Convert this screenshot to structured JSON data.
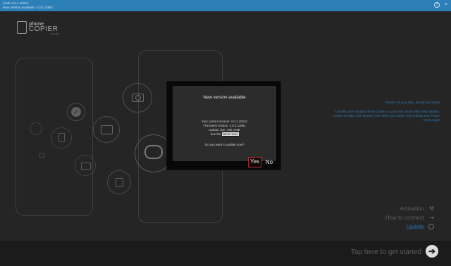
{
  "titlebar": {
    "line1": "Vmdr 4.0.1.10216",
    "line2": "New version available: 4.0.2.11691",
    "help_icon": "?",
    "close_icon": "×"
  },
  "logo": {
    "line1": "phone",
    "line2": "COPIER",
    "line3": "by Vmdr"
  },
  "right_panel": {
    "tagline": "Transfer all your data, quickly and easily",
    "description": "Transfer your valuable phone content to your new phone with a few minutes. Content remains both phones, even when you switch from Android and iPhone easily to get"
  },
  "menu": {
    "activation": "Activation",
    "how_to_connect": "How to connect",
    "update": "Update"
  },
  "bottom_bar": {
    "get_started": "Tap here to get started",
    "arrow_icon": "➔"
  },
  "dialog": {
    "title": "New version available",
    "current_version": "Your current version: 4.0.1.10216",
    "latest_version": "The latest version: 4.0.2.11691",
    "update_size": "Update size: 160.4 MB",
    "see_the": "See the",
    "latest_news": "latest news",
    "question": "Do you want to update now?",
    "yes_label": "Yes",
    "no_label": "No"
  },
  "icons": {
    "check": "✓",
    "wrench": "⚒",
    "connect": "⇥"
  },
  "colors": {
    "titlebar": "#2d7fb8",
    "accent_link": "#2f7bb4",
    "yes_border": "#c1272d",
    "background": "#252525"
  }
}
